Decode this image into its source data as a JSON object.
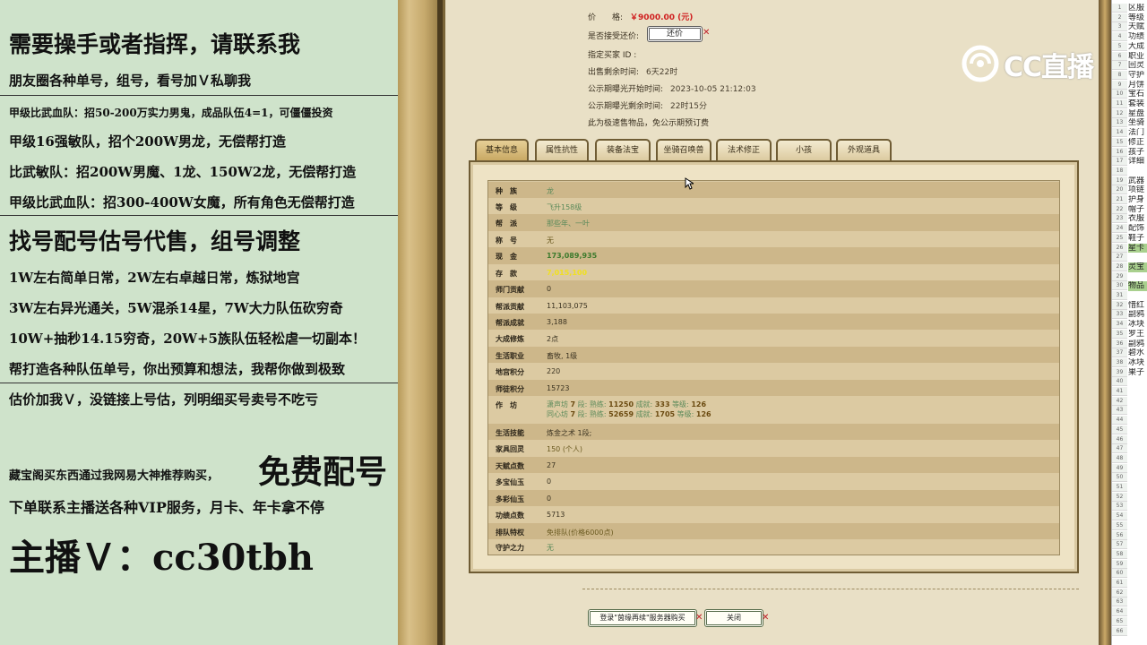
{
  "overlay": {
    "lines": [
      "需要操手或者指挥，请联系我",
      "朋友圈各种单号，组号，看号加Ｖ私聊我",
      "甲级比武血队：招50-200万实力男鬼，成品队伍4=1，可僵僵投资",
      "甲级16强敏队，招个200W男龙，无偿帮打造",
      "比武敏队：招200W男魔、1龙、150W2龙，无偿帮打造",
      "甲级比武血队：招300-400W女魔，所有角色无偿帮打造",
      "找号配号估号代售，组号调整",
      "1W左右简单日常，2W左右卓越日常，炼狱地宫",
      "3W左右异光通关，5W混杀14星，7W大力队伍砍穷奇",
      "10W+抽秒14.15穷奇，20W+5族队伍轻松虐一切副本！",
      "帮打造各种队伍单号，你出预算和想法，我帮你做到极致",
      "估价加我Ｖ，没链接上号估，列明细买号卖号不吃亏",
      "藏宝阁买东西通过我网易大神推荐购买，",
      "免费配号",
      "下单联系主播送各种VIP服务，月卡、年卡拿不停",
      "主播Ｖ：cc30tbh"
    ]
  },
  "listing": {
    "price_label": "价　　格:",
    "price_value": "￥9000.00 (元)",
    "bargain_label": "是否接受还价:",
    "bargain_button": "还价",
    "buyer_label": "指定买家 ID :",
    "remaining_label": "出售剩余时间:",
    "remaining_value": "6天22时",
    "public_start_label": "公示期曝光开始时间:",
    "public_start_value": "2023-10-05 21:12:03",
    "public_remaining_label": "公示期曝光剩余时间:",
    "public_remaining_value": "22时15分",
    "note": "此为极速售物品，免公示期预订费"
  },
  "tabs": [
    "基本信息",
    "属性抗性",
    "装备法宝",
    "坐骑召唤兽",
    "法术修正",
    "小孩",
    "外观道具"
  ],
  "table": {
    "rows": [
      {
        "label": "种　族",
        "value": "龙",
        "style": "teal"
      },
      {
        "label": "等　级",
        "value": "飞升158级",
        "style": "teal"
      },
      {
        "label": "帮　派",
        "value": "那些年、一叶",
        "style": "teal"
      },
      {
        "label": "称　号",
        "value": "无",
        "style": "olive"
      },
      {
        "label": "现　金",
        "value": "173,089,935",
        "style": "green"
      },
      {
        "label": "存　款",
        "value": "7,015,100",
        "style": "yellow"
      },
      {
        "label": "师门贡献",
        "value": "0",
        "style": "dark"
      },
      {
        "label": "帮派贡献",
        "value": "11,103,075",
        "style": "dark"
      },
      {
        "label": "帮派成就",
        "value": "3,188",
        "style": "dark"
      },
      {
        "label": "大成修炼",
        "value": "2点",
        "style": "dark"
      },
      {
        "label": "生活职业",
        "value": "畜牧, 1级",
        "style": "dark"
      },
      {
        "label": "地宫积分",
        "value": "220",
        "style": "dark"
      },
      {
        "label": "师徒积分",
        "value": "15723",
        "style": "dark"
      }
    ],
    "workshop": {
      "label": "作　坊",
      "lines": [
        {
          "a": "潇声坊",
          "b": "7",
          "c": "段:",
          "d": "熟练:",
          "e": "11250",
          "f": "成就:",
          "g": "333",
          "h": "等级:",
          "i": "126"
        },
        {
          "a": "同心坊",
          "b": "7",
          "c": "段:",
          "d": "熟练:",
          "e": "52659",
          "f": "成就:",
          "g": "1705",
          "h": "等级:",
          "i": "126"
        }
      ]
    },
    "rows2": [
      {
        "label": "生活技能",
        "value": "炼金之术 1段;",
        "style": "dark"
      },
      {
        "label": "家具回灵",
        "value": "150 (个人)",
        "style": "olive"
      },
      {
        "label": "天赋点数",
        "value": "27",
        "style": "dark"
      },
      {
        "label": "多宝仙玉",
        "value": "0",
        "style": "dark"
      },
      {
        "label": "多彩仙玉",
        "value": "0",
        "style": "dark"
      },
      {
        "label": "功绩点数",
        "value": "5713",
        "style": "dark"
      },
      {
        "label": "排队特权",
        "value": "免排队(价格6000点)",
        "style": "olive"
      },
      {
        "label": "守护之力",
        "value": "无",
        "style": "teal"
      }
    ]
  },
  "buttons": {
    "login": "登录\"茵缘再续\"服务器购买",
    "close": "关闭"
  },
  "logo": {
    "text": "CC直播"
  },
  "sheet": {
    "numbers": [
      "1",
      "2",
      "3",
      "4",
      "5",
      "6",
      "7",
      "8",
      "9",
      "10",
      "11",
      "12",
      "13",
      "14",
      "15",
      "16",
      "17",
      "18",
      "19",
      "20",
      "21",
      "22",
      "23",
      "24",
      "25",
      "26",
      "27",
      "28",
      "29",
      "30",
      "31",
      "32",
      "33",
      "34",
      "35",
      "36",
      "37",
      "38",
      "39",
      "40",
      "41",
      "42",
      "43",
      "44",
      "45",
      "46",
      "47",
      "48",
      "49",
      "50",
      "51",
      "52",
      "53",
      "54",
      "55",
      "56",
      "57",
      "58",
      "59",
      "60",
      "61",
      "62",
      "63",
      "64",
      "65",
      "66"
    ],
    "cells": [
      "区服",
      "等级",
      "天赋",
      "功绩",
      "大成",
      "职业",
      "回灵",
      "守护",
      "月饼",
      "宝石",
      "套装",
      "星盘",
      "坐骑",
      "法门",
      "修正",
      "孩子",
      "详细",
      "",
      "武器",
      "项链",
      "护身",
      "帽子",
      "衣服",
      "配饰",
      "鞋子",
      "星卡",
      "",
      "灵宝",
      "",
      "物品",
      "",
      "惜红",
      "副鸦",
      "冰块",
      "罗王",
      "副鸦",
      "碧水",
      "冰块",
      "果子"
    ]
  }
}
